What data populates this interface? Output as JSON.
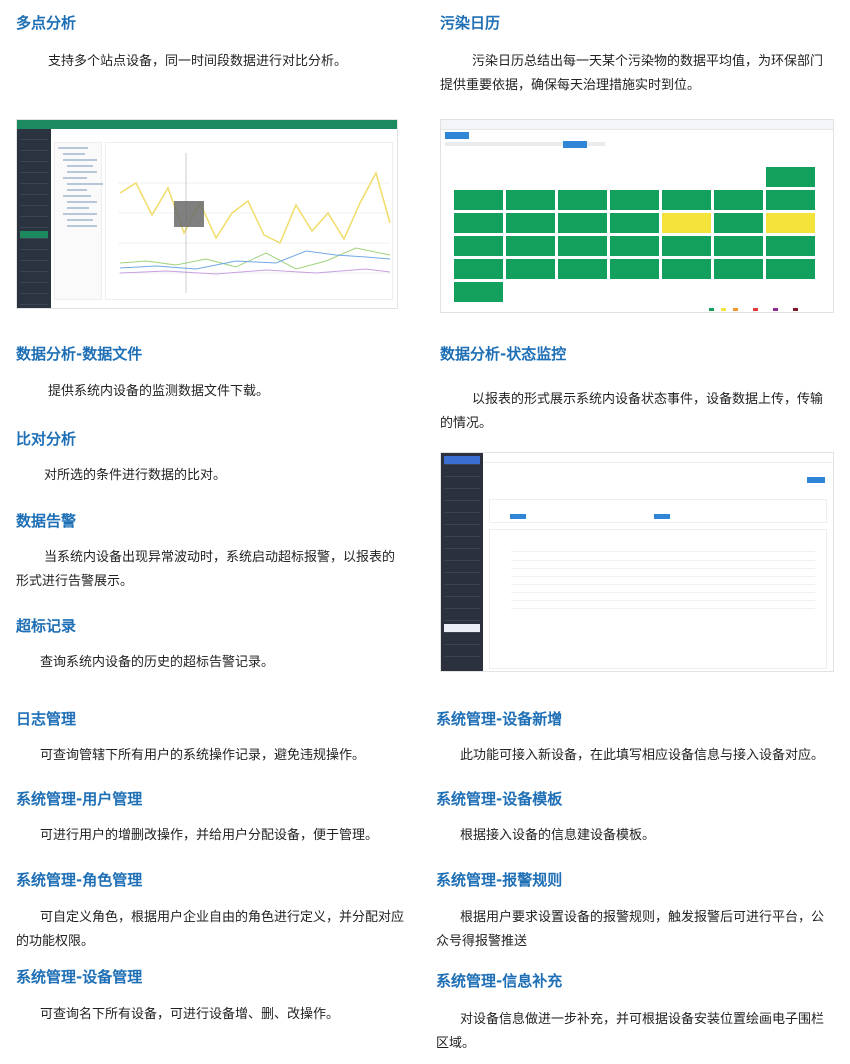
{
  "sections": {
    "s1": {
      "title": "多点分析",
      "body": "支持多个站点设备，同一时间段数据进行对比分析。"
    },
    "s2": {
      "title": "污染日历",
      "body": "污染日历总结出每一天某个污染物的数据平均值，为环保部门提供重要依据，确保每天治理措施实时到位。"
    },
    "s3": {
      "title": "数据分析-数据文件",
      "body": "提供系统内设备的监测数据文件下载。"
    },
    "s4": {
      "title": "数据分析-状态监控",
      "body": "以报表的形式展示系统内设备状态事件，设备数据上传，传输的情况。"
    },
    "s5": {
      "title": "比对分析",
      "body": "对所选的条件进行数据的比对。"
    },
    "s6": {
      "title": "数据告警",
      "body": "当系统内设备出现异常波动时，系统启动超标报警，以报表的形式进行告警展示。"
    },
    "s7": {
      "title": "超标记录",
      "body": "查询系统内设备的历史的超标告警记录。"
    },
    "s8": {
      "title": "日志管理",
      "body": "可查询管辖下所有用户的系统操作记录，避免违规操作。"
    },
    "s9": {
      "title": "系统管理-设备新增",
      "body": "此功能可接入新设备，在此填写相应设备信息与接入设备对应。"
    },
    "s10": {
      "title": "系统管理-用户管理",
      "body": "可进行用户的增删改操作，并给用户分配设备，便于管理。"
    },
    "s11": {
      "title": "系统管理-设备模板",
      "body": "根据接入设备的信息建设备模板。"
    },
    "s12": {
      "title": "系统管理-角色管理",
      "body": "可自定义角色，根据用户企业自由的角色进行定义，并分配对应的功能权限。"
    },
    "s13": {
      "title": "系统管理-报警规则",
      "body": "根据用户要求设置设备的报警规则，触发报警后可进行平台，公众号得报警推送"
    },
    "s14": {
      "title": "系统管理-设备管理",
      "body": "可查询名下所有设备，可进行设备增、删、改操作。"
    },
    "s15": {
      "title": "系统管理-信息补充",
      "body": "对设备信息做进一步补充，并可根据设备安装位置绘画电子围栏区域。"
    }
  },
  "colors": {
    "title": "#1e6fb5",
    "green": "#12a05c",
    "yellow": "#f4e33b",
    "nav": "#2c3340"
  }
}
